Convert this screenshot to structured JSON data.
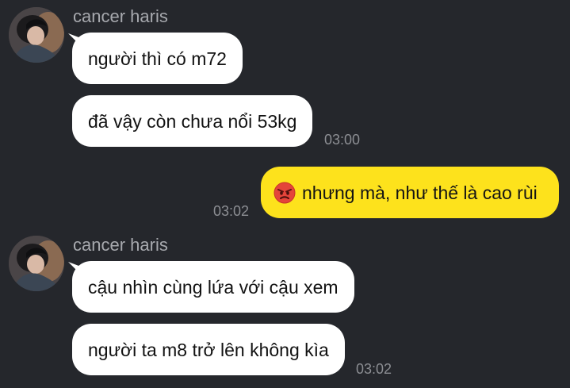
{
  "colors": {
    "background": "#25272c",
    "incoming_bubble": "#ffffff",
    "outgoing_bubble": "#fde21c",
    "sender_name": "#a7a9ae",
    "timestamp": "#8c8e93"
  },
  "groups": [
    {
      "sender": "cancer haris",
      "avatar_icon": "profile-photo",
      "messages": [
        {
          "text": "người thì có m72"
        },
        {
          "text": "đã vậy còn chưa nổi 53kg"
        }
      ],
      "time": "03:00"
    },
    {
      "sender": "me",
      "messages": [
        {
          "emoji_icon": "angry-face-icon",
          "text": "nhưng mà, như thế là cao rùi"
        }
      ],
      "time": "03:02"
    },
    {
      "sender": "cancer haris",
      "avatar_icon": "profile-photo",
      "messages": [
        {
          "text": "cậu nhìn cùng lứa với cậu xem"
        },
        {
          "text": "người ta m8 trở lên không kìa"
        }
      ],
      "time": "03:02"
    }
  ]
}
